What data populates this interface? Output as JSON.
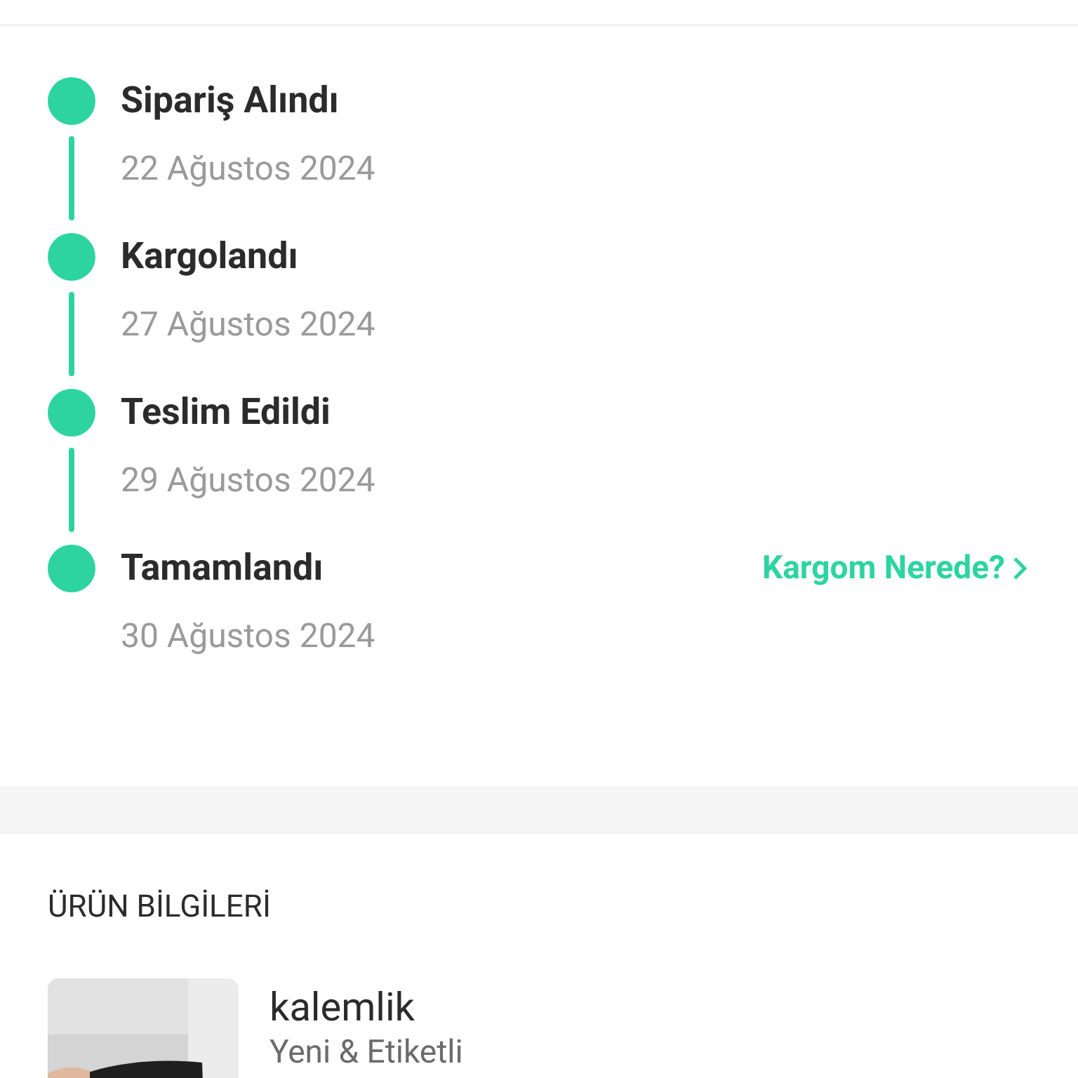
{
  "timeline": [
    {
      "title": "Sipariş Alındı",
      "date": "22 Ağustos 2024",
      "done": true
    },
    {
      "title": "Kargolandı",
      "date": "27 Ağustos 2024",
      "done": true
    },
    {
      "title": "Teslim Edildi",
      "date": "29 Ağustos 2024",
      "done": true
    },
    {
      "title": "Tamamlandı",
      "date": "30 Ağustos 2024",
      "done": true,
      "link": "Kargom Nerede?"
    }
  ],
  "product_section": {
    "heading": "ÜRÜN BİLGİLERİ",
    "products": [
      {
        "kind": "picture",
        "name": "kalemlik",
        "condition": "Yeni & Etiketli"
      }
    ]
  }
}
